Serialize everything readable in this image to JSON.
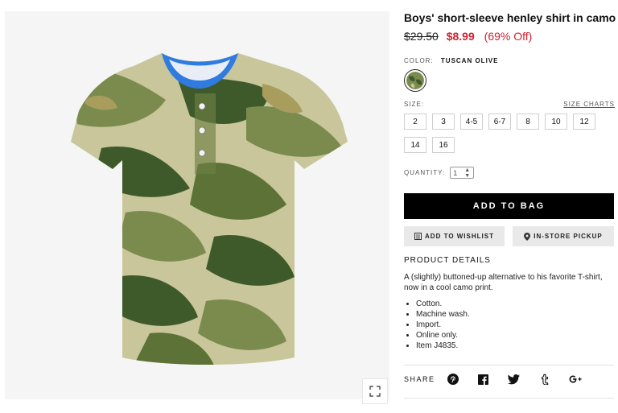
{
  "product": {
    "title": "Boys' short-sleeve henley shirt in camo",
    "price_old": "$29.50",
    "price_new": "$8.99",
    "price_off": "(69% Off)"
  },
  "color": {
    "label": "COLOR:",
    "value": "TUSCAN OLIVE"
  },
  "size": {
    "label": "SIZE:",
    "charts_link": "SIZE CHARTS",
    "options": [
      "2",
      "3",
      "4-5",
      "6-7",
      "8",
      "10",
      "12",
      "14",
      "16"
    ]
  },
  "quantity": {
    "label": "QUANTITY:",
    "value": "1"
  },
  "actions": {
    "add_to_bag": "ADD TO BAG",
    "wishlist": "ADD TO WISHLIST",
    "pickup": "IN-STORE PICKUP"
  },
  "details": {
    "title": "PRODUCT DETAILS",
    "description": "A (slightly) buttoned-up alternative to his favorite T-shirt, now in a cool camo print.",
    "bullets": [
      "Cotton.",
      "Machine wash.",
      "Import.",
      "Online only.",
      "Item J4835."
    ]
  },
  "share": {
    "label": "SHARE",
    "icons": [
      "pinterest-icon",
      "facebook-icon",
      "twitter-icon",
      "tumblr-icon",
      "google-plus-icon"
    ]
  },
  "colors": {
    "accent_red": "#d0202f",
    "camo_dark": "#3f5a2a",
    "camo_mid": "#7b8b4e",
    "camo_light": "#c8c69a",
    "collar_blue": "#2f7be0"
  }
}
